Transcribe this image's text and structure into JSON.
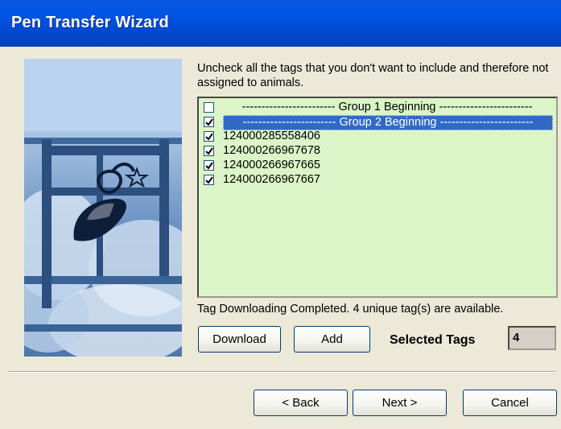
{
  "window": {
    "title": "Pen Transfer Wizard"
  },
  "instructions": "Uncheck all the tags that you don't want to include and therefore not assigned to animals.",
  "tag_list": [
    {
      "label": "------------------------ Group 1 Beginning ------------------------",
      "checked": false,
      "selected": false
    },
    {
      "label": "------------------------ Group 2 Beginning ------------------------",
      "checked": true,
      "selected": true
    },
    {
      "label": "124000285558406",
      "checked": true,
      "selected": false
    },
    {
      "label": "124000266967678",
      "checked": true,
      "selected": false
    },
    {
      "label": "124000266967665",
      "checked": true,
      "selected": false
    },
    {
      "label": "124000266967667",
      "checked": true,
      "selected": false
    }
  ],
  "status_text": "Tag Downloading Completed. 4 unique tag(s) are available.",
  "buttons": {
    "download": "Download",
    "add": "Add",
    "back": "< Back",
    "next": "Next >",
    "cancel": "Cancel"
  },
  "selected_tags": {
    "label": "Selected Tags",
    "value": "4"
  },
  "colors": {
    "title_bar": "#0055e5",
    "list_bg": "#dcf5c8",
    "selection": "#316ac5"
  }
}
